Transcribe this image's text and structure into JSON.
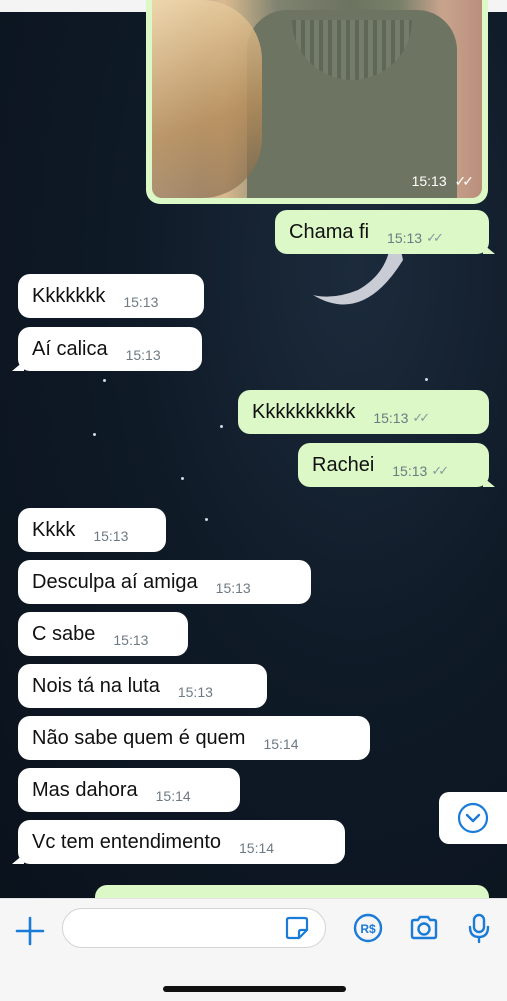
{
  "image_message": {
    "time": "15:13",
    "ticks": "✓✓"
  },
  "messages": [
    {
      "dir": "out",
      "text": "Chama fi",
      "time": "15:13",
      "ticks": "✓✓"
    },
    {
      "dir": "in",
      "text": "Kkkkkkk",
      "time": "15:13"
    },
    {
      "dir": "in",
      "text": "Aí calica",
      "time": "15:13"
    },
    {
      "dir": "out",
      "text": "Kkkkkkkkkk",
      "time": "15:13",
      "ticks": "✓✓"
    },
    {
      "dir": "out",
      "text": "Rachei",
      "time": "15:13",
      "ticks": "✓✓"
    },
    {
      "dir": "in",
      "text": "Kkkk",
      "time": "15:13"
    },
    {
      "dir": "in",
      "text": "Desculpa aí amiga",
      "time": "15:13"
    },
    {
      "dir": "in",
      "text": "C sabe",
      "time": "15:13"
    },
    {
      "dir": "in",
      "text": "Nois tá na luta",
      "time": "15:13"
    },
    {
      "dir": "in",
      "text": "Não sabe quem é quem",
      "time": "15:14"
    },
    {
      "dir": "in",
      "text": "Mas dahora",
      "time": "15:14"
    },
    {
      "dir": "in",
      "text": "Vc tem entendimento",
      "time": "15:14"
    }
  ],
  "input_bar": {
    "icons": [
      "plus-icon",
      "sticker-icon",
      "pix-payment-icon",
      "camera-icon",
      "microphone-icon"
    ],
    "accent": "#1a7bd8"
  },
  "scroll_down_icon": "chevron-down-circle-icon"
}
